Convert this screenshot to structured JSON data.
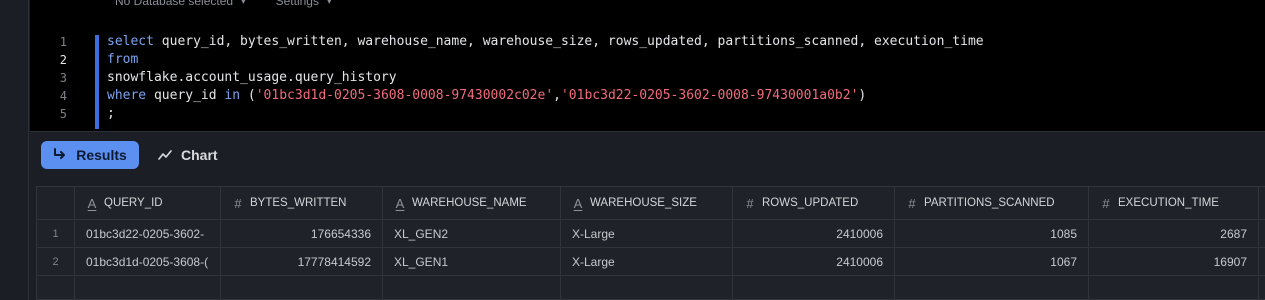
{
  "topbar": {
    "database_label": "No Database selected",
    "settings_label": "Settings"
  },
  "editor": {
    "line_numbers": [
      "1",
      "2",
      "3",
      "4",
      "5"
    ],
    "active_line": "2",
    "lines": [
      [
        {
          "t": "kw",
          "v": "select"
        },
        {
          "t": "plain",
          "v": " query_id, bytes_written, warehouse_name, warehouse_size, rows_updated, partitions_scanned, execution_time"
        }
      ],
      [
        {
          "t": "kw",
          "v": "from"
        }
      ],
      [
        {
          "t": "plain",
          "v": "snowflake.account_usage.query_history"
        }
      ],
      [
        {
          "t": "kw",
          "v": "where"
        },
        {
          "t": "plain",
          "v": " query_id "
        },
        {
          "t": "kw",
          "v": "in"
        },
        {
          "t": "plain",
          "v": " ("
        },
        {
          "t": "str",
          "v": "'01bc3d1d-0205-3608-0008-97430002c02e'"
        },
        {
          "t": "plain",
          "v": ","
        },
        {
          "t": "str",
          "v": "'01bc3d22-0205-3602-0008-97430001a0b2'"
        },
        {
          "t": "plain",
          "v": ")"
        }
      ],
      [
        {
          "t": "plain",
          "v": ";"
        }
      ]
    ]
  },
  "toolbar": {
    "results_label": "Results",
    "chart_label": "Chart"
  },
  "table": {
    "columns": [
      {
        "label": "QUERY_ID",
        "type": "text"
      },
      {
        "label": "BYTES_WRITTEN",
        "type": "number"
      },
      {
        "label": "WAREHOUSE_NAME",
        "type": "text"
      },
      {
        "label": "WAREHOUSE_SIZE",
        "type": "text"
      },
      {
        "label": "ROWS_UPDATED",
        "type": "number"
      },
      {
        "label": "PARTITIONS_SCANNED",
        "type": "number"
      },
      {
        "label": "EXECUTION_TIME",
        "type": "number"
      }
    ],
    "rows": [
      {
        "index": "1",
        "cells": [
          "01bc3d22-0205-3602-",
          "176654336",
          "XL_GEN2",
          "X-Large",
          "2410006",
          "1085",
          "2687"
        ]
      },
      {
        "index": "2",
        "cells": [
          "01bc3d1d-0205-3608-(",
          "17778414592",
          "XL_GEN1",
          "X-Large",
          "2410006",
          "1067",
          "16907"
        ]
      }
    ]
  }
}
